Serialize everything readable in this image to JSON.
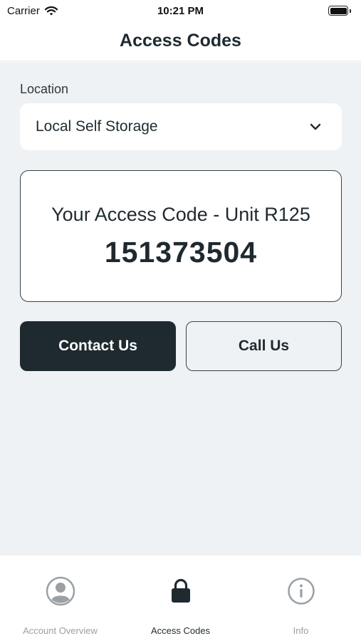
{
  "status_bar": {
    "carrier": "Carrier",
    "time": "10:21 PM"
  },
  "header": {
    "title": "Access Codes"
  },
  "location": {
    "label": "Location",
    "selected": "Local Self Storage"
  },
  "access_card": {
    "heading": "Your Access Code - Unit R125",
    "code": "151373504"
  },
  "buttons": {
    "contact": "Contact Us",
    "call": "Call Us"
  },
  "tabs": [
    {
      "label": "Account Overview",
      "icon": "person-icon",
      "active": false
    },
    {
      "label": "Access Codes",
      "icon": "lock-icon",
      "active": true
    },
    {
      "label": "Info",
      "icon": "info-icon",
      "active": false
    }
  ],
  "colors": {
    "primary": "#1f2a30",
    "background": "#eef2f5",
    "inactive_tab": "#9aa0a4"
  }
}
